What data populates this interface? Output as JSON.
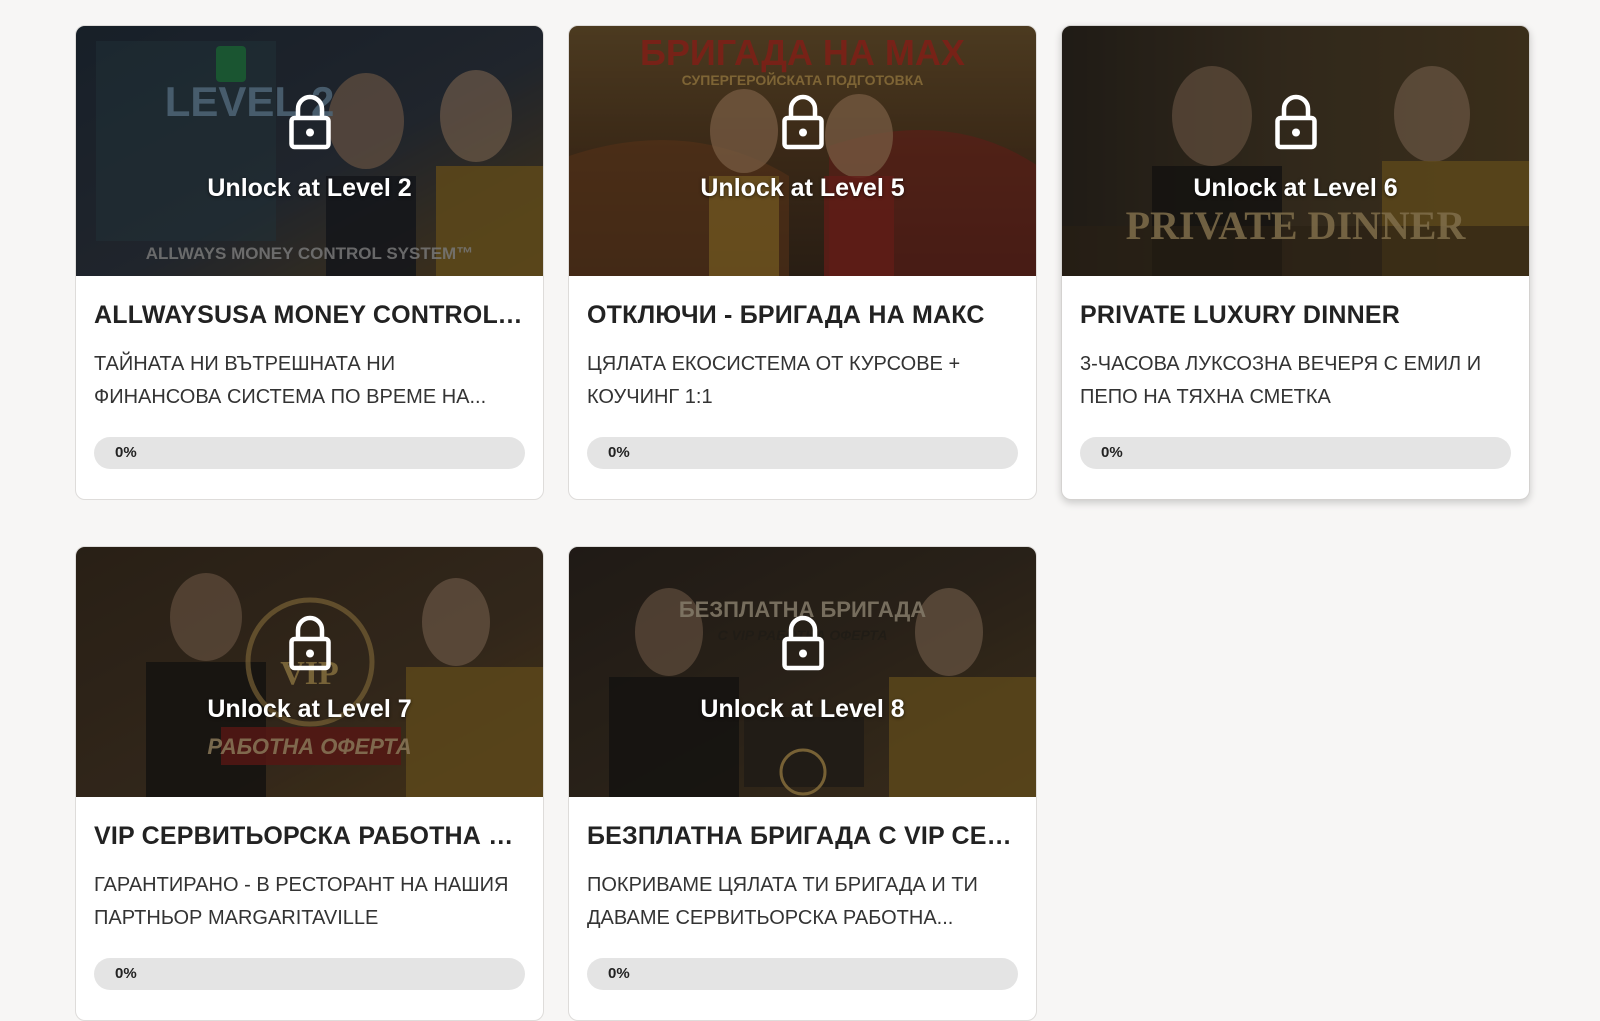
{
  "cards": [
    {
      "unlock_label": "Unlock at Level 2",
      "title": "ALLWAYSUSA MONEY CONTROL SYSTEM",
      "description": "ТАЙНАТА НИ ВЪТРЕШНАТА НИ ФИНАНСОВА СИСТЕМА ПО ВРЕМЕ НА...",
      "progress_label": "0%",
      "progress": 0,
      "image_text_top": "LEVEL 2",
      "image_text_bottom": "ALLWAYS MONEY CONTROL SYSTEM™"
    },
    {
      "unlock_label": "Unlock at Level 5",
      "title": "ОТКЛЮЧИ - БРИГАДА НА МАКС",
      "description": "ЦЯЛАТА ЕКОСИСТЕМА ОТ КУРСОВЕ + КОУЧИНГ 1:1",
      "progress_label": "0%",
      "progress": 0,
      "image_text_top": "БРИГАДА НА МАХ",
      "image_text_bottom": "СУПЕРГЕРОЙСКАТА ПОДГОТОВКА"
    },
    {
      "unlock_label": "Unlock at Level 6",
      "title": "PRIVATE LUXURY DINNER",
      "description": "3-ЧАСОВА ЛУКСОЗНА ВЕЧЕРЯ С ЕМИЛ И ПЕПО НА ТЯХНА СМЕТКА",
      "progress_label": "0%",
      "progress": 0,
      "image_text_top": "",
      "image_text_bottom": "PRIVATE DINNER"
    },
    {
      "unlock_label": "Unlock at Level 7",
      "title": "VIP СЕРВИТЬОРСКА РАБОТНА ОФЕРТА",
      "description": "ГАРАНТИРАНО - В РЕСТОРАНТ НА НАШИЯ ПАРТНЬОР MARGARITAVILLE",
      "progress_label": "0%",
      "progress": 0,
      "image_text_top": "VIP",
      "image_text_bottom": "РАБОТНА ОФЕРТА"
    },
    {
      "unlock_label": "Unlock at Level 8",
      "title": "БЕЗПЛАТНА БРИГАДА С VIP СЕРВИТЬОРСКА РАБОТНА ОФЕРТА",
      "description": "ПОКРИВАМЕ ЦЯЛАТА ТИ БРИГАДА И ТИ ДАВАМЕ СЕРВИТЬОРСКА РАБОТНА...",
      "progress_label": "0%",
      "progress": 0,
      "image_text_top": "БЕЗПЛАТНА БРИГАДА",
      "image_text_bottom": "С VIP РАБОТНА ОФЕРТА"
    }
  ],
  "colors": {
    "page_bg": "#f7f6f5",
    "card_bg": "#ffffff",
    "progress_track": "#e4e4e4",
    "title_text": "#222222"
  },
  "icons": {
    "lock": "lock-icon"
  }
}
